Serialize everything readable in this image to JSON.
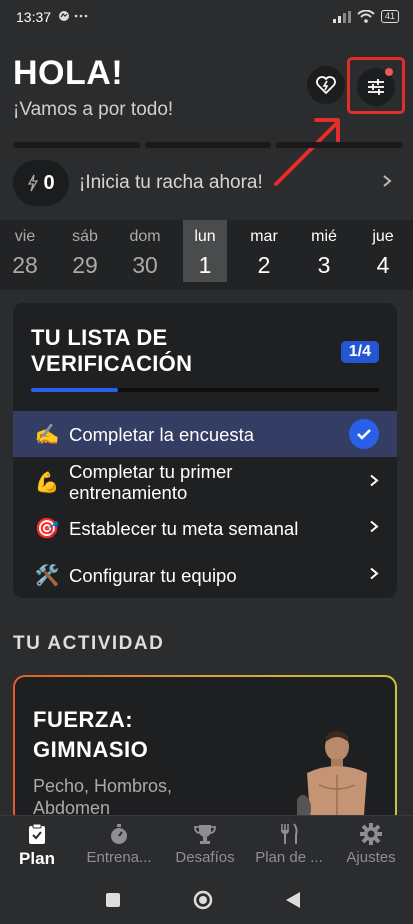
{
  "status_bar": {
    "time": "13:37",
    "left_icons": "⬤ ···",
    "battery": "41"
  },
  "header": {
    "title": "HOLA!",
    "subtitle": "¡Vamos a por todo!"
  },
  "streak": {
    "count": "0",
    "text": "¡Inicia tu racha ahora!"
  },
  "week": [
    {
      "name": "vie",
      "date": "28",
      "state": "past"
    },
    {
      "name": "sáb",
      "date": "29",
      "state": "past"
    },
    {
      "name": "dom",
      "date": "30",
      "state": "past"
    },
    {
      "name": "lun",
      "date": "1",
      "state": "today"
    },
    {
      "name": "mar",
      "date": "2",
      "state": "future"
    },
    {
      "name": "mié",
      "date": "3",
      "state": "future"
    },
    {
      "name": "jue",
      "date": "4",
      "state": "future"
    }
  ],
  "checklist": {
    "title_line1": "TU LISTA DE",
    "title_line2": "VERIFICACIÓN",
    "badge": "1/4",
    "progress": 0.25,
    "items": [
      {
        "emoji": "✍️",
        "label": "Completar la encuesta",
        "done": true
      },
      {
        "emoji": "💪",
        "label": "Completar tu primer entrenamiento",
        "done": false
      },
      {
        "emoji": "🎯",
        "label": "Establecer tu meta semanal",
        "done": false
      },
      {
        "emoji": "🛠️",
        "label": "Configurar tu equipo",
        "done": false
      }
    ]
  },
  "activity": {
    "section_title": "TU ACTIVIDAD",
    "card_title_line1": "FUERZA:",
    "card_title_line2": "GIMNASIO",
    "card_sub_line1": "Pecho, Hombros,",
    "card_sub_line2": "Abdomen"
  },
  "tabs": [
    {
      "label": "Plan",
      "icon": "clipboard-icon",
      "active": true
    },
    {
      "label": "Entrena...",
      "icon": "stopwatch-icon",
      "active": false
    },
    {
      "label": "Desafíos",
      "icon": "trophy-icon",
      "active": false
    },
    {
      "label": "Plan de ...",
      "icon": "fork-knife-icon",
      "active": false
    },
    {
      "label": "Ajustes",
      "icon": "gear-icon",
      "active": false
    }
  ],
  "colors": {
    "accent": "#2a5fe8",
    "highlight": "#e32d2d",
    "background": "#2b2c2e"
  }
}
